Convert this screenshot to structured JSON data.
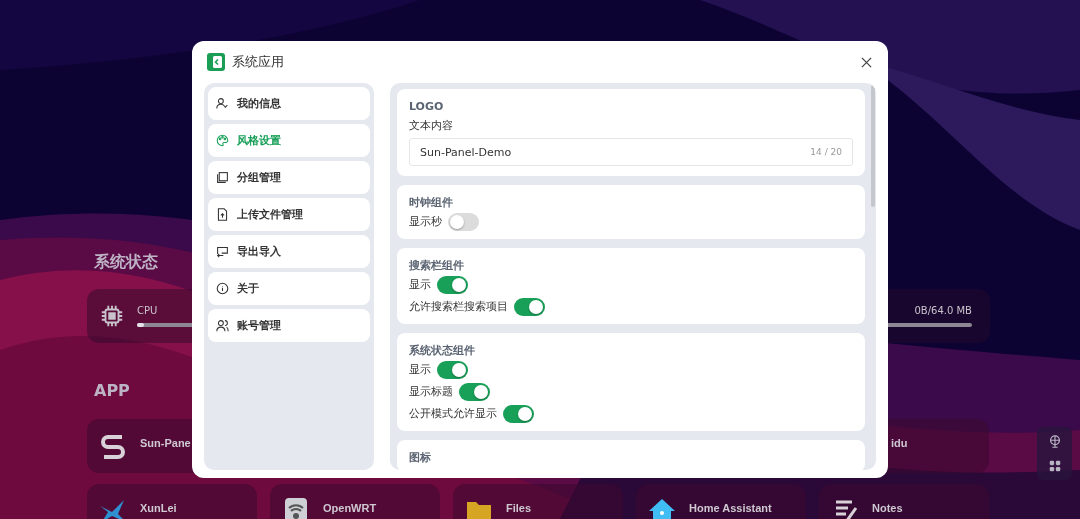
{
  "dashboard": {
    "status_title": "系统状态",
    "status_cards": [
      {
        "kind": "cpu",
        "label": "CPU",
        "level": 0.03
      },
      {
        "kind": "memory",
        "reading": "0B/64.0 MB",
        "level": 0.02
      }
    ],
    "app_title": "APP",
    "app_rows": [
      [
        {
          "kind": "full",
          "label": "Sun-Pane"
        },
        {
          "kind": "partial",
          "label": "idu"
        }
      ],
      [
        {
          "kind": "full",
          "label": "XunLei"
        },
        {
          "kind": "full",
          "label": "OpenWRT"
        },
        {
          "kind": "full",
          "label": "Files"
        },
        {
          "kind": "full",
          "label": "Home Assistant"
        },
        {
          "kind": "full",
          "label": "Notes"
        }
      ]
    ]
  },
  "dialog": {
    "title": "系统应用",
    "menu": [
      {
        "label": "我的信息",
        "selected": false
      },
      {
        "label": "风格设置",
        "selected": true
      },
      {
        "label": "分组管理",
        "selected": false
      },
      {
        "label": "上传文件管理",
        "selected": false
      },
      {
        "label": "导出导入",
        "selected": false
      },
      {
        "label": "关于",
        "selected": false
      },
      {
        "label": "账号管理",
        "selected": false
      }
    ],
    "sections": [
      {
        "title": "LOGO",
        "fields": [
          {
            "kind": "text",
            "label": "文本内容",
            "value": "Sun-Panel-Demo",
            "counter": "14 / 20"
          }
        ]
      },
      {
        "title": "时钟组件",
        "fields": [
          {
            "kind": "switch",
            "label": "显示秒",
            "on": false
          }
        ]
      },
      {
        "title": "搜索栏组件",
        "fields": [
          {
            "kind": "switch",
            "label": "显示",
            "on": true
          },
          {
            "kind": "switch",
            "label": "允许搜索栏搜索项目",
            "on": true
          }
        ]
      },
      {
        "title": "系统状态组件",
        "fields": [
          {
            "kind": "switch",
            "label": "显示",
            "on": true
          },
          {
            "kind": "switch",
            "label": "显示标题",
            "on": true
          },
          {
            "kind": "switch",
            "label": "公开模式允许显示",
            "on": true
          }
        ]
      },
      {
        "title": "图标"
      }
    ]
  }
}
